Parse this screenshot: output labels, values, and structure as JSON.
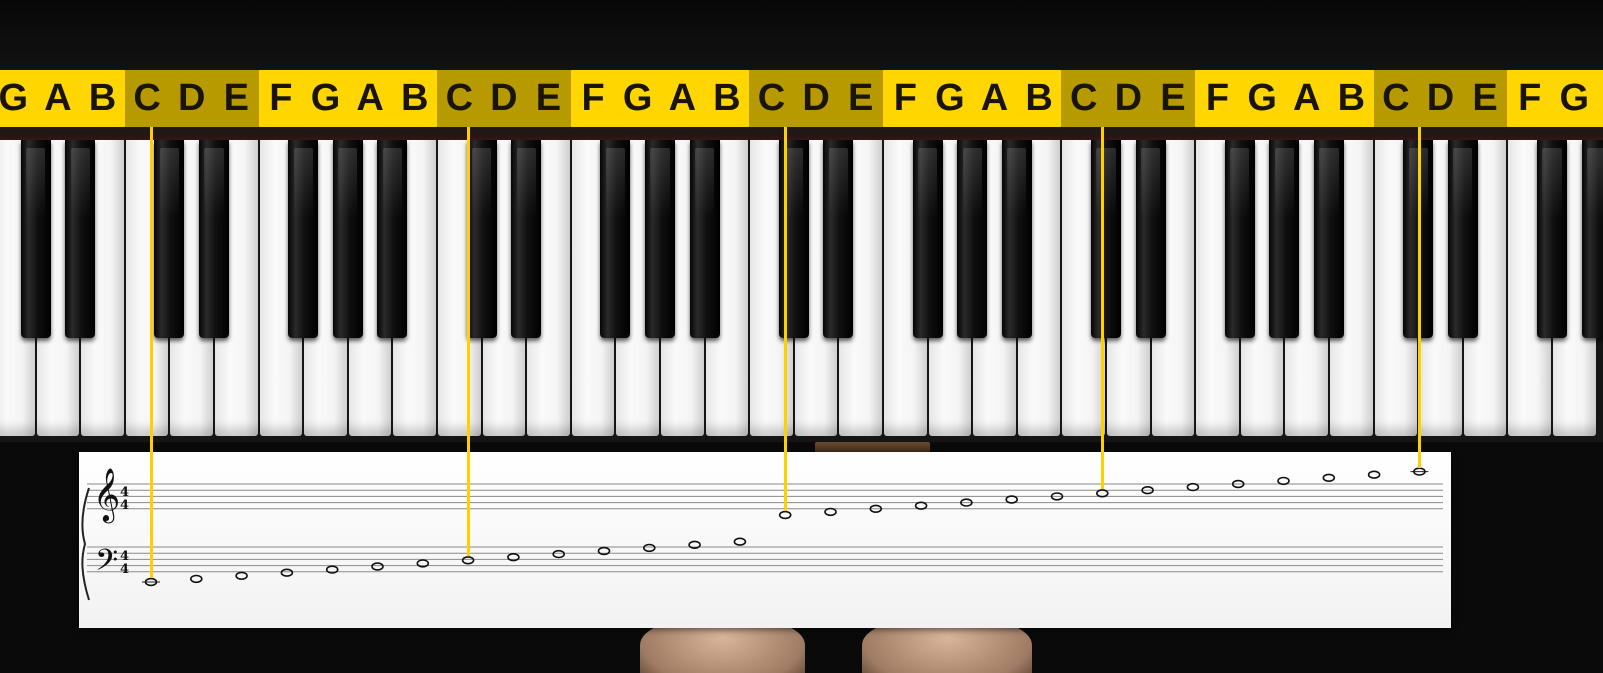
{
  "note_strip": {
    "letters": [
      "G",
      "A",
      "B",
      "C",
      "D",
      "E",
      "F",
      "G",
      "A",
      "B",
      "C",
      "D",
      "E",
      "F",
      "G",
      "A",
      "B",
      "C",
      "D",
      "E",
      "F",
      "G",
      "A",
      "B",
      "C",
      "D",
      "E",
      "F",
      "G",
      "A",
      "B",
      "C",
      "D",
      "E",
      "F",
      "G"
    ],
    "highlight_letter": "C",
    "strip_color": "#ffd600",
    "highlight_color": "#b79a00"
  },
  "keyboard": {
    "white_key_count": 36,
    "lowest_visible_white_key": "G"
  },
  "score": {
    "treble_clef": "𝄞",
    "bass_clef": "𝄢",
    "treble_time_signature": "4/4",
    "bass_time_signature": "4/4",
    "treble_time_top": "4",
    "treble_time_bottom": "4",
    "bass_time_top": "4",
    "bass_time_bottom": "4",
    "note_glyph": "whole-note",
    "bass_notes": [
      "C2",
      "D2",
      "E2",
      "F2",
      "G2",
      "A2",
      "B2",
      "C3",
      "D3",
      "E3",
      "F3",
      "G3",
      "A3",
      "B3"
    ],
    "treble_notes": [
      "C4",
      "D4",
      "E4",
      "F4",
      "G4",
      "A4",
      "B4",
      "C5",
      "D5",
      "E5",
      "F5",
      "G5",
      "A5",
      "B5",
      "C6"
    ]
  },
  "guide_lines": {
    "color": "#ffd000",
    "targets": [
      "C2",
      "C3",
      "C4",
      "C5",
      "C6"
    ]
  }
}
